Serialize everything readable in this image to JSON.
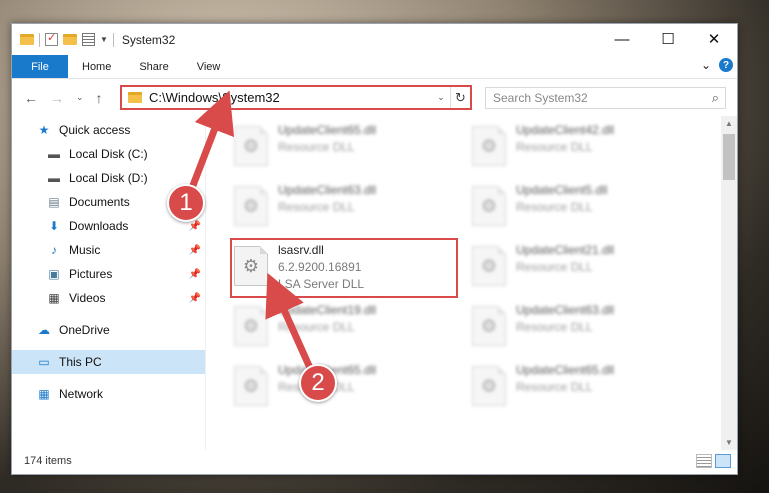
{
  "window": {
    "title": "System32",
    "controls": {
      "minimize": "—",
      "maximize": "☐",
      "close": "✕"
    }
  },
  "ribbon": {
    "tabs": [
      "File",
      "Home",
      "Share",
      "View"
    ],
    "expand": "⌄",
    "help": "?"
  },
  "address": {
    "path": "C:\\Windows\\System32",
    "dropdown": "⌄",
    "refresh": "↻"
  },
  "search": {
    "placeholder": "Search System32",
    "icon": "⌕"
  },
  "nav_buttons": {
    "back": "←",
    "forward": "→",
    "recent": "⌄",
    "up": "↑"
  },
  "sidebar": {
    "items": [
      {
        "label": "Quick access",
        "icon": "star-icon"
      },
      {
        "label": "Local Disk (C:)",
        "icon": "drive-icon"
      },
      {
        "label": "Local Disk (D:)",
        "icon": "drive-icon"
      },
      {
        "label": "Documents",
        "icon": "documents-icon"
      },
      {
        "label": "Downloads",
        "icon": "download-icon"
      },
      {
        "label": "Music",
        "icon": "music-icon"
      },
      {
        "label": "Pictures",
        "icon": "pictures-icon"
      },
      {
        "label": "Videos",
        "icon": "videos-icon"
      },
      {
        "label": "OneDrive",
        "icon": "cloud-icon"
      },
      {
        "label": "This PC",
        "icon": "computer-icon"
      },
      {
        "label": "Network",
        "icon": "network-icon"
      }
    ]
  },
  "files": {
    "left": [
      {
        "name": "UpdateClient65.dll",
        "type": "Resource DLL"
      },
      {
        "name": "UpdateClient63.dll",
        "type": "Resource DLL"
      },
      {
        "name": "lsasrv.dll",
        "version": "6.2.9200.16891",
        "type": "LSA Server DLL"
      },
      {
        "name": "UpdateClient19.dll",
        "type": "Resource DLL"
      },
      {
        "name": "UpdateClient65.dll",
        "type": "Resource DLL"
      }
    ],
    "right": [
      {
        "name": "UpdateClient42.dll",
        "type": "Resource DLL"
      },
      {
        "name": "UpdateClient5.dll",
        "type": "Resource DLL"
      },
      {
        "name": "UpdateClient21.dll",
        "type": "Resource DLL"
      },
      {
        "name": "UpdateClient63.dll",
        "type": "Resource DLL"
      },
      {
        "name": "UpdateClient65.dll",
        "type": "Resource DLL"
      }
    ]
  },
  "status": {
    "item_count": "174 items"
  },
  "callouts": [
    "1",
    "2"
  ],
  "colors": {
    "accent": "#1979ca",
    "highlight": "#d94a4a",
    "selection": "#cce4f7"
  }
}
